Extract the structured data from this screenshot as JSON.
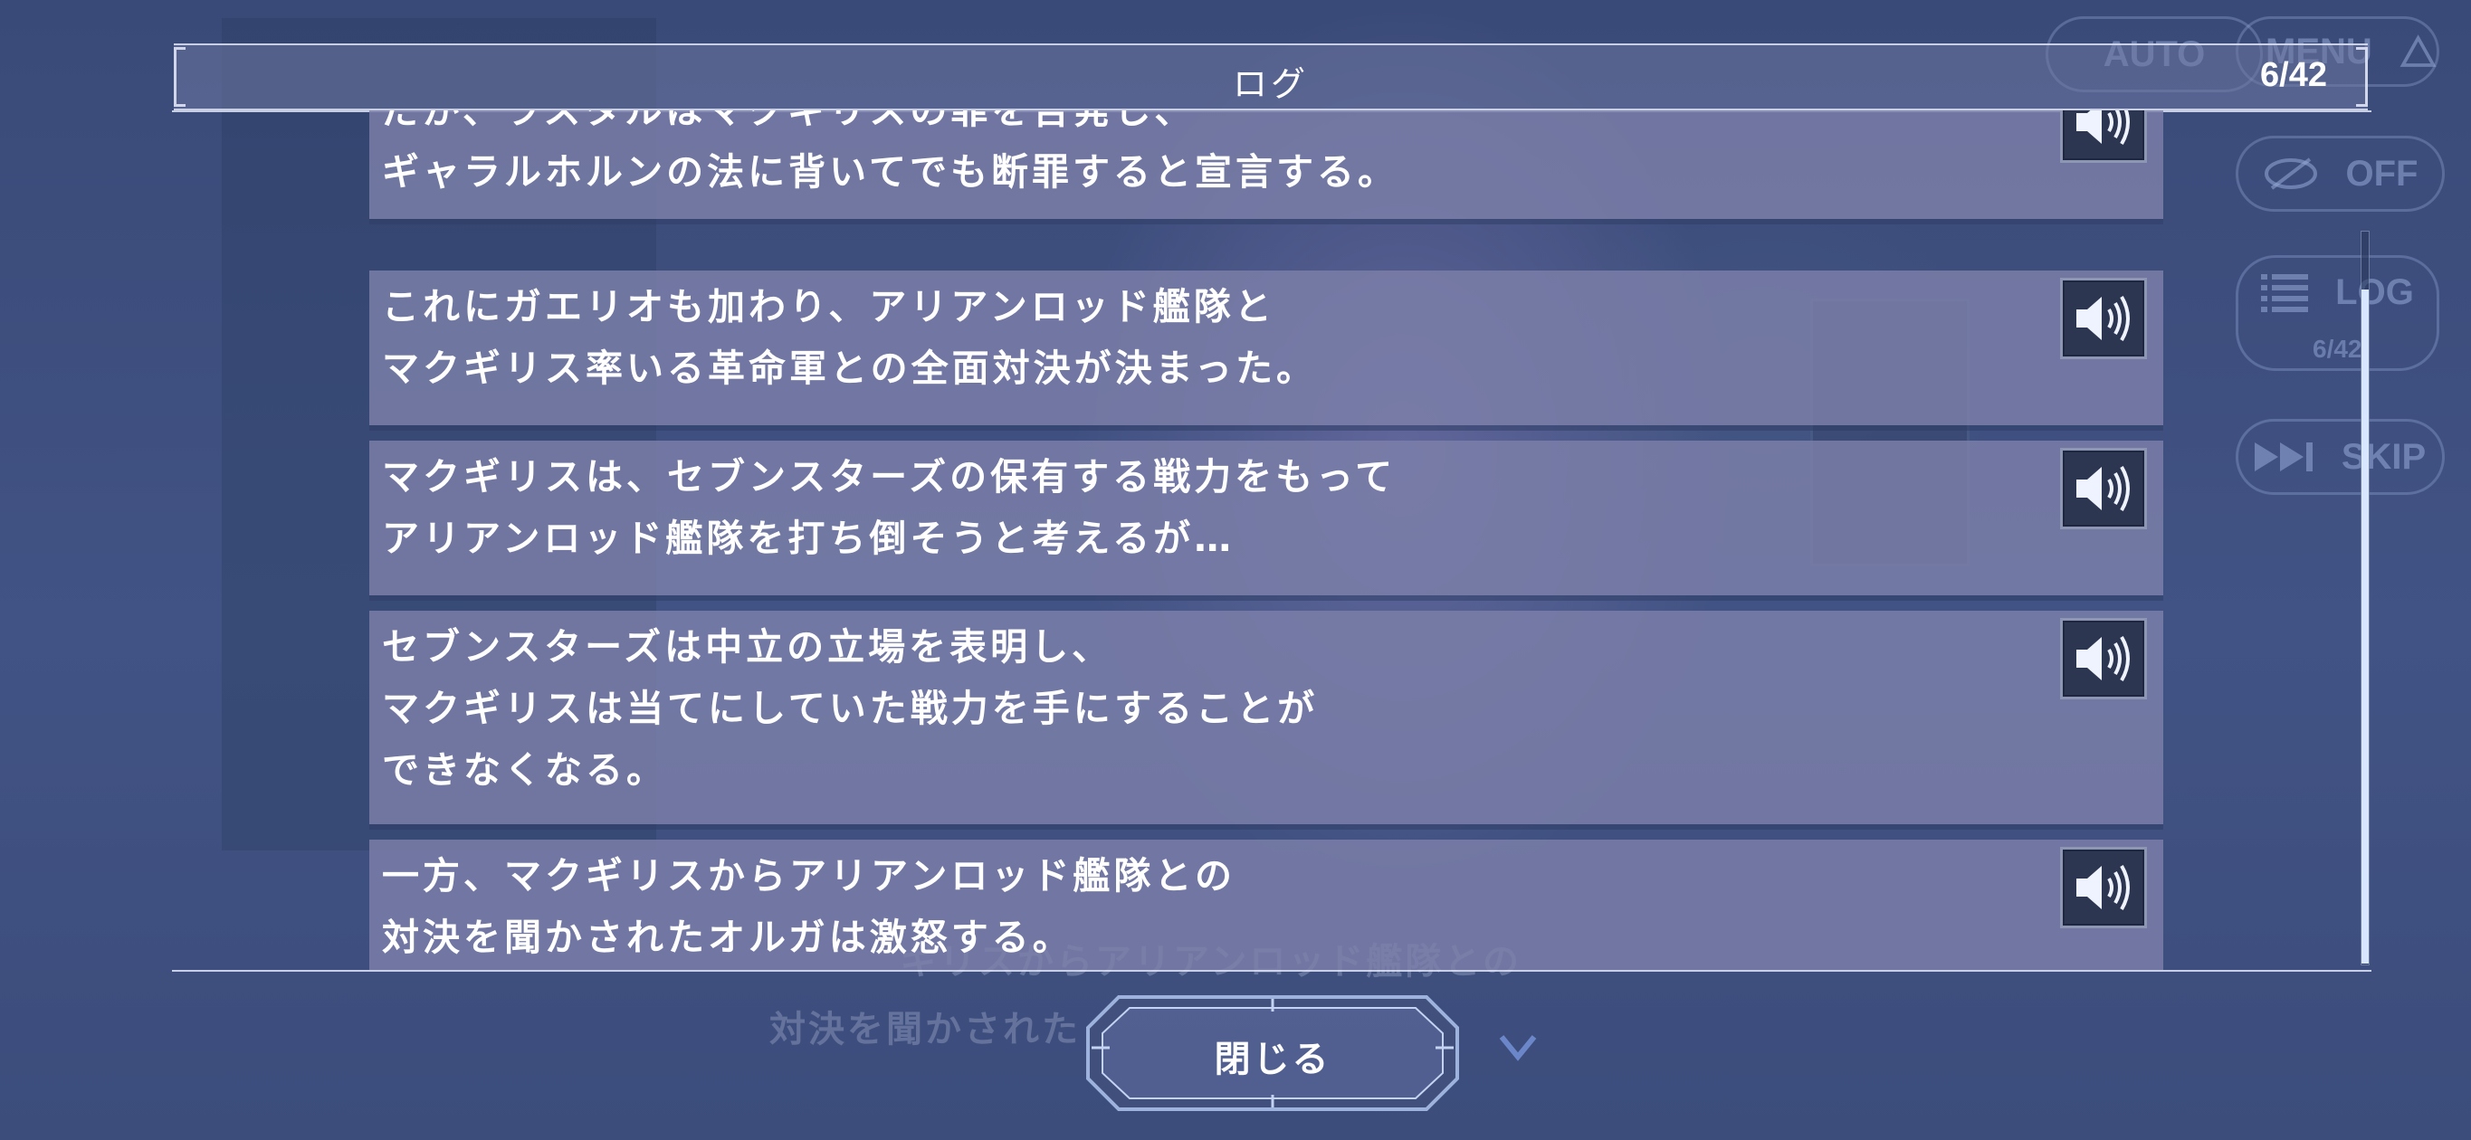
{
  "hud": {
    "auto_label": "AUTO",
    "menu_label": "MENU",
    "hide_label": "OFF",
    "log_label": "LOG",
    "log_count": "6/42",
    "skip_label": "SKIP"
  },
  "log": {
    "title": "ログ",
    "counter": "6/42",
    "entries": [
      {
        "text": "だが、ラスタルはマクギリスの罪を告発し、\nギャラルホルンの法に背いてでも断罪すると宣言する。"
      },
      {
        "text": "これにガエリオも加わり、アリアンロッド艦隊と\nマクギリス率いる革命軍との全面対決が決まった。"
      },
      {
        "text": "マクギリスは、セブンスターズの保有する戦力をもって\nアリアンロッド艦隊を打ち倒そうと考えるが…"
      },
      {
        "text": "セブンスターズは中立の立場を表明し、\nマクギリスは当てにしていた戦力を手にすることが\nできなくなる。"
      },
      {
        "text": "一方、マクギリスからアリアンロッド艦隊との\n対決を聞かされたオルガは激怒する。"
      }
    ],
    "scroll_position": 0.98
  },
  "background_text": {
    "line1": "ギリスからアリアンロッド艦隊との",
    "line2": "対決を聞かされた"
  },
  "close_label": "閉じる",
  "colors": {
    "panel": "#7d80aa",
    "background": "#3c4d7c",
    "accent": "#d9e6ff"
  }
}
